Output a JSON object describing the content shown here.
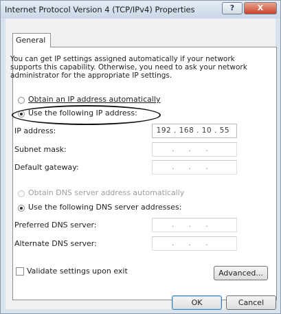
{
  "window": {
    "title": "Internet Protocol Version 4 (TCP/IPv4) Properties",
    "help_label": "?",
    "close_label": "X"
  },
  "tabs": [
    {
      "label": "General",
      "selected": true
    }
  ],
  "description": "You can get IP settings assigned automatically if your network supports this capability. Otherwise, you need to ask your network administrator for the appropriate IP settings.",
  "ip_options": {
    "auto_label": "Obtain an IP address automatically",
    "manual_label": "Use the following IP address:",
    "selected": "manual"
  },
  "ip_fields": {
    "ip_address": {
      "label": "IP address:",
      "value": "192 . 168 .  10  .  55"
    },
    "subnet_mask": {
      "label": "Subnet mask:",
      "value": ".  .  ."
    },
    "default_gateway": {
      "label": "Default gateway:",
      "value": ".  .  ."
    }
  },
  "dns_options": {
    "auto_label": "Obtain DNS server address automatically",
    "manual_label": "Use the following DNS server addresses:",
    "selected": "manual"
  },
  "dns_fields": {
    "preferred": {
      "label": "Preferred DNS server:",
      "value": ".  .  ."
    },
    "alternate": {
      "label": "Alternate DNS server:",
      "value": ".  .  ."
    }
  },
  "validate": {
    "label": "Validate settings upon exit",
    "checked": false
  },
  "buttons": {
    "advanced": "Advanced...",
    "ok": "OK",
    "cancel": "Cancel"
  },
  "colors": {
    "title_gradient_top": "#e4ecf5",
    "close_button": "#c8452b",
    "default_button_border": "#3c7fb1",
    "highlight_oval": "#111111"
  }
}
